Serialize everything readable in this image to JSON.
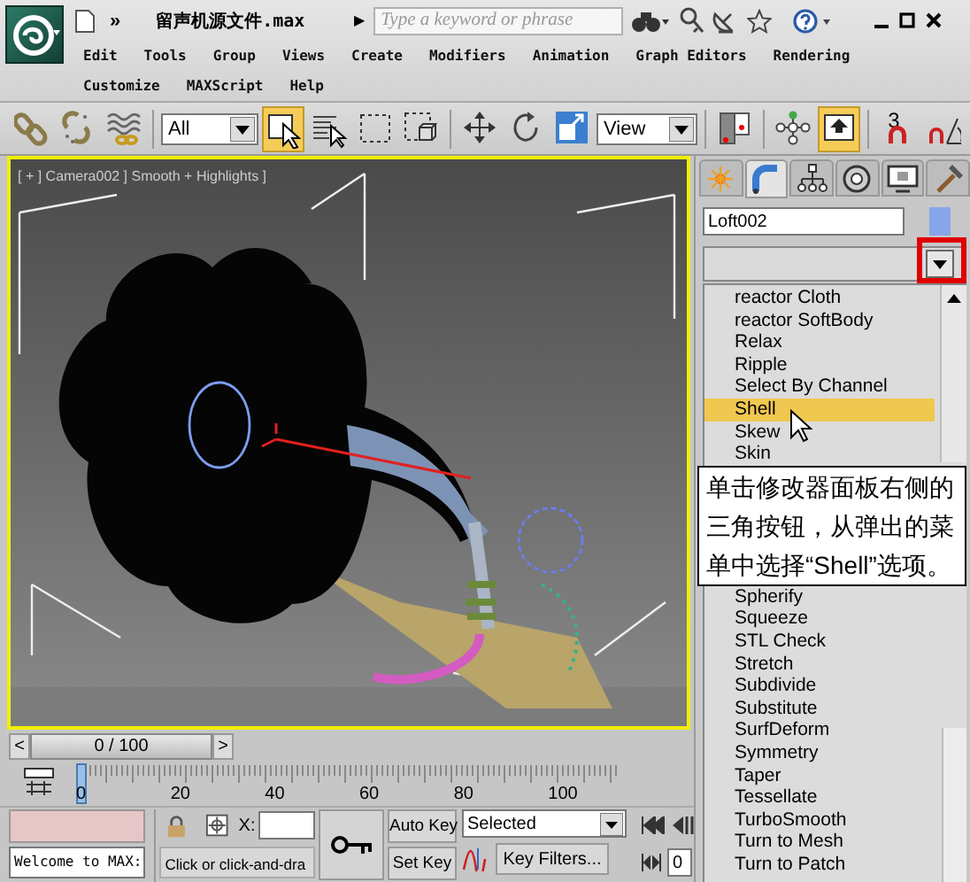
{
  "app_bar": {
    "overflow": "»",
    "title": "留声机源文件.max",
    "arrow": "▶",
    "search": {
      "placeholder": "Type a keyword or phrase"
    }
  },
  "menu_rows": [
    {
      "items": [
        "Edit",
        "Tools",
        "Group",
        "Views",
        "Create",
        "Modifiers",
        "Animation",
        "Graph Editors",
        "Rendering"
      ]
    },
    {
      "items": [
        "Customize",
        "MAXScript",
        "Help"
      ]
    }
  ],
  "toolbar": {
    "items": [
      {
        "kind": "button",
        "active": false
      },
      {
        "kind": "button",
        "active": false
      },
      {
        "kind": "button",
        "active": false
      },
      {
        "kind": "dropdown",
        "value": "All"
      },
      {
        "kind": "button",
        "active": true
      },
      {
        "kind": "button",
        "active": false
      },
      {
        "kind": "button",
        "active": false
      },
      {
        "kind": "button",
        "active": false
      },
      {
        "kind": "button",
        "active": false
      },
      {
        "kind": "button",
        "active": false
      },
      {
        "kind": "button",
        "active": false
      },
      {
        "kind": "dropdown",
        "value": "View"
      },
      {
        "kind": "button",
        "active": false
      },
      {
        "kind": "button",
        "active": false
      },
      {
        "kind": "button",
        "active": true
      },
      {
        "kind": "button",
        "label": "3",
        "active": false
      },
      {
        "kind": "button",
        "active": false
      }
    ]
  },
  "viewport": {
    "label": "[ + ] Camera002 ] Smooth + Highlights ]",
    "active": true
  },
  "command_panel": {
    "tabs": [
      {
        "selected": false
      },
      {
        "selected": true
      },
      {
        "selected": false
      },
      {
        "selected": false
      },
      {
        "selected": false
      },
      {
        "selected": false
      }
    ],
    "object_name": "Loft002",
    "modifier_list": {
      "open": true,
      "items": [
        {
          "kind": "item",
          "label": "reactor Cloth",
          "selected": false
        },
        {
          "kind": "item",
          "label": "reactor SoftBody",
          "selected": false
        },
        {
          "kind": "item",
          "label": "Relax",
          "selected": false
        },
        {
          "kind": "item",
          "label": "Ripple",
          "selected": false
        },
        {
          "kind": "item",
          "label": "Select By Channel",
          "selected": false
        },
        {
          "kind": "item",
          "label": "Shell",
          "selected": true
        },
        {
          "kind": "item",
          "label": "Skew",
          "selected": false
        },
        {
          "kind": "item",
          "label": "Skin",
          "selected": false
        },
        {
          "kind": "note",
          "text": "单击修改器面板右侧的三角按钮，从弹出的菜单中选择“Shell”选项。"
        },
        {
          "kind": "item",
          "label": "Spherify",
          "selected": false
        },
        {
          "kind": "item",
          "label": "Squeeze",
          "selected": false
        },
        {
          "kind": "item",
          "label": "STL Check",
          "selected": false
        },
        {
          "kind": "item",
          "label": "Stretch",
          "selected": false
        },
        {
          "kind": "item",
          "label": "Subdivide",
          "selected": false
        },
        {
          "kind": "item",
          "label": "Substitute",
          "selected": false
        },
        {
          "kind": "item",
          "label": "SurfDeform",
          "selected": false
        },
        {
          "kind": "item",
          "label": "Symmetry",
          "selected": false
        },
        {
          "kind": "item",
          "label": "Taper",
          "selected": false
        },
        {
          "kind": "item",
          "label": "Tessellate",
          "selected": false
        },
        {
          "kind": "item",
          "label": "TurboSmooth",
          "selected": false
        },
        {
          "kind": "item",
          "label": "Turn to Mesh",
          "selected": false
        },
        {
          "kind": "item",
          "label": "Turn to Patch",
          "selected": false
        }
      ]
    }
  },
  "timeline": {
    "level": 0,
    "prev": "<",
    "position": "0 / 100",
    "next": ">",
    "ticks": [
      "0",
      "20",
      "40",
      "60",
      "80",
      "100"
    ]
  },
  "status": {
    "listener": "Welcome to MAX:",
    "x_label": "X:",
    "prompt": "Click or click-and-dra"
  },
  "keys": {
    "auto_key": {
      "label": "Auto Key",
      "on": false
    },
    "set_key": "Set Key",
    "key_mode": "Selected",
    "key_filters": "Key Filters...",
    "frame": "0"
  }
}
